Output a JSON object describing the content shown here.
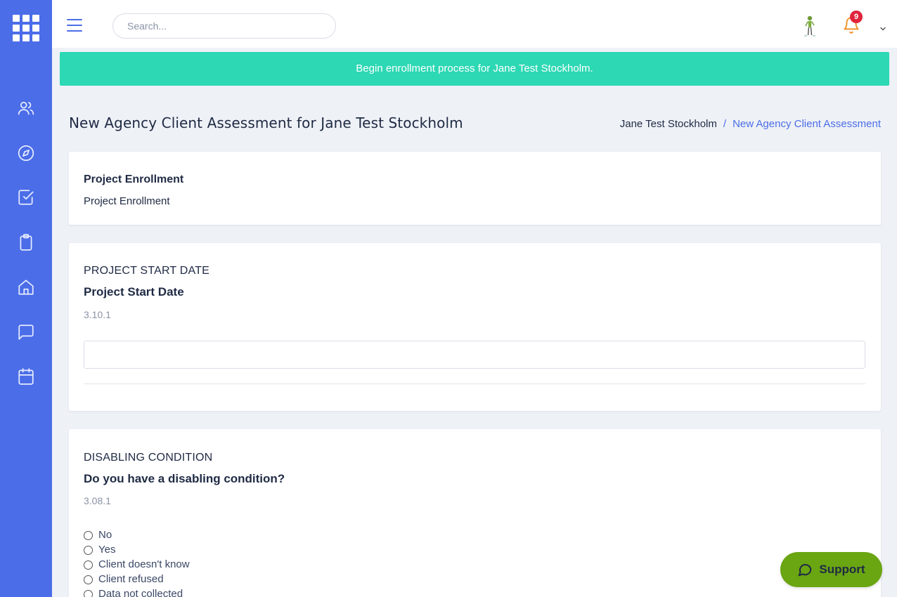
{
  "topbar": {
    "search_placeholder": "Search...",
    "notification_count": "9"
  },
  "sidebar": {
    "items": [
      {
        "icon": "users-icon"
      },
      {
        "icon": "compass-icon"
      },
      {
        "icon": "checkbox-icon"
      },
      {
        "icon": "clipboard-icon"
      },
      {
        "icon": "home-icon"
      },
      {
        "icon": "message-icon"
      },
      {
        "icon": "calendar-icon"
      }
    ]
  },
  "alert": {
    "message": "Begin enrollment process for Jane Test Stockholm."
  },
  "page": {
    "title": "New Agency Client Assessment for Jane Test Stockholm",
    "breadcrumb": {
      "parent": "Jane Test Stockholm",
      "separator": "/",
      "current": "New Agency Client Assessment"
    }
  },
  "sections": {
    "enrollment": {
      "title": "Project Enrollment",
      "subtitle": "Project Enrollment"
    },
    "start_date": {
      "caps_label": "PROJECT START DATE",
      "question": "Project Start Date",
      "code": "3.10.1",
      "value": ""
    },
    "disabling": {
      "caps_label": "DISABLING CONDITION",
      "question": "Do you have a disabling condition?",
      "code": "3.08.1",
      "options": [
        "No",
        "Yes",
        "Client doesn't know",
        "Client refused",
        "Data not collected"
      ]
    }
  },
  "support": {
    "label": "Support"
  },
  "colors": {
    "sidebar": "#4b6de8",
    "alert": "#2dd8b4",
    "support": "#6aa512",
    "badge": "#e0243b",
    "link": "#4b6de8"
  }
}
